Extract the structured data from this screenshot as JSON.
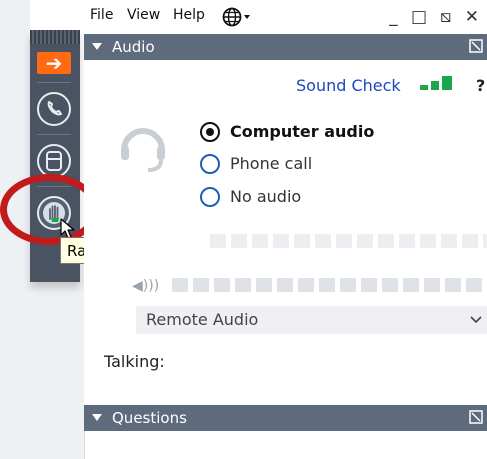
{
  "menubar": {
    "file": "File",
    "view": "View",
    "help": "Help",
    "globe_icon": "globe-icon",
    "window_buttons": "_ □ ⧅ ✕"
  },
  "toolbar": {
    "arrow_glyph": "➔",
    "phone_icon": "phone-icon",
    "video_icon": "video-icon",
    "hand_icon": "raise-hand-icon"
  },
  "tooltip": {
    "text": "Raise hand"
  },
  "audio_section": {
    "title": "Audio",
    "sound_check": "Sound Check",
    "help": "?",
    "options": [
      {
        "label": "Computer audio",
        "selected": true
      },
      {
        "label": "Phone call",
        "selected": false
      },
      {
        "label": "No audio",
        "selected": false
      }
    ],
    "speaker_select": "Remote Audio",
    "talking_label": "Talking:"
  },
  "questions_section": {
    "title": "Questions"
  },
  "colors": {
    "accent": "#ff6a13",
    "link": "#1a48c4",
    "signal": "#1aa64a",
    "section_bar": "#5e6b7c",
    "highlight_ring": "#c21b1b"
  }
}
